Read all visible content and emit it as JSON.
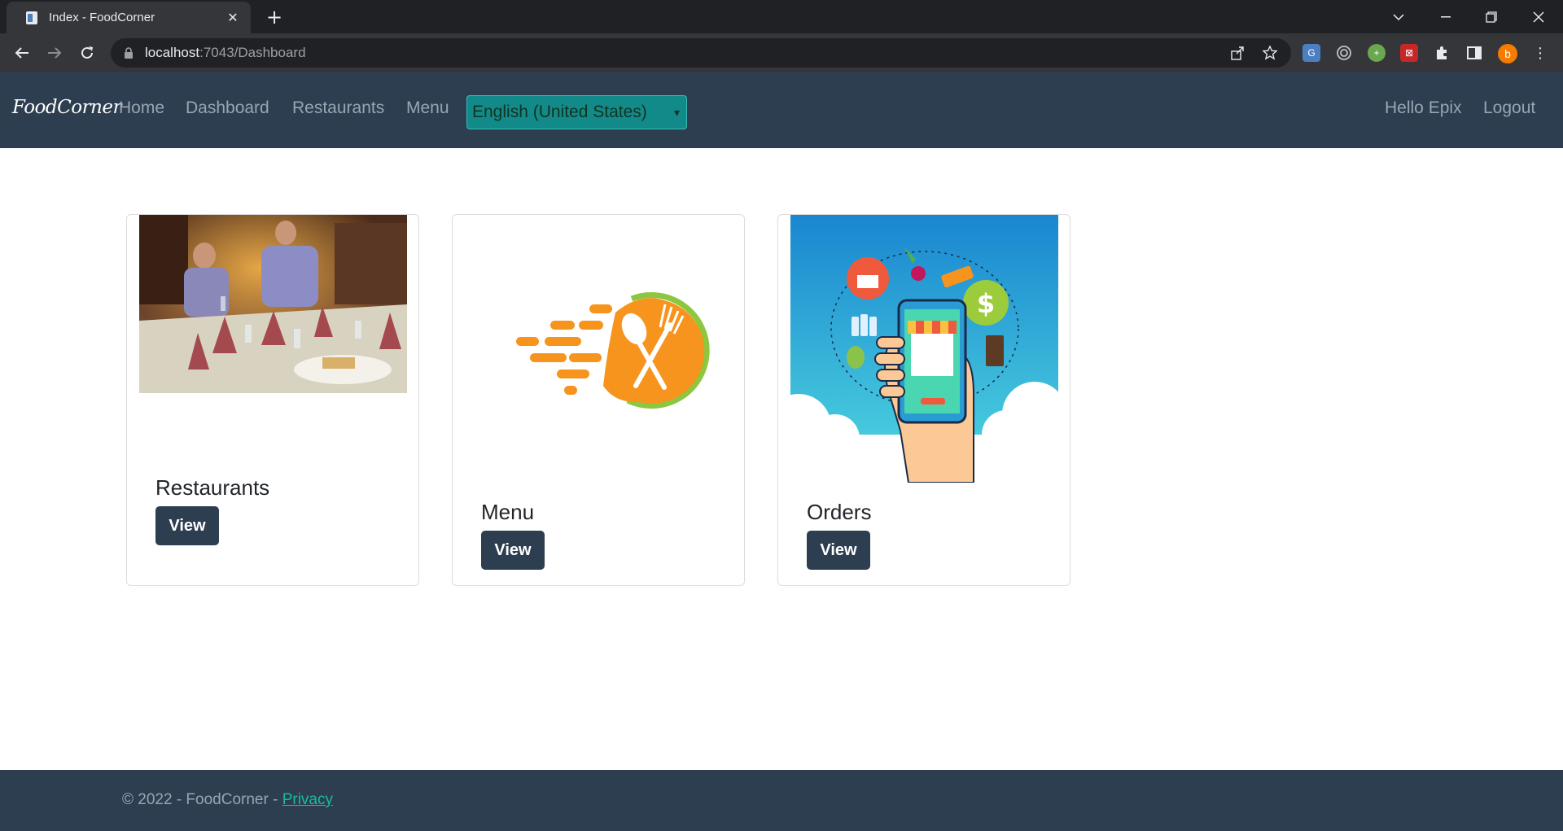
{
  "browser": {
    "tab_title": "Index - FoodCorner",
    "url_host": "localhost",
    "url_path": ":7043/Dashboard",
    "profile_initial": "b"
  },
  "navbar": {
    "brand": "FoodCorner",
    "links": [
      "Home",
      "Dashboard",
      "Restaurants",
      "Menu"
    ],
    "language_selected": "English (United States)",
    "greeting": "Hello Epix",
    "logout": "Logout"
  },
  "cards": [
    {
      "title": "Restaurants",
      "button": "View"
    },
    {
      "title": "Menu",
      "button": "View"
    },
    {
      "title": "Orders",
      "button": "View"
    }
  ],
  "footer": {
    "copyright": "© 2022 - FoodCorner - ",
    "privacy": "Privacy"
  },
  "colors": {
    "navbar_bg": "#2c3e50",
    "accent_teal": "#18bc9c",
    "select_bg": "#128a8a",
    "menu_logo_orange": "#f7941d",
    "menu_logo_green": "#8dc63f"
  }
}
